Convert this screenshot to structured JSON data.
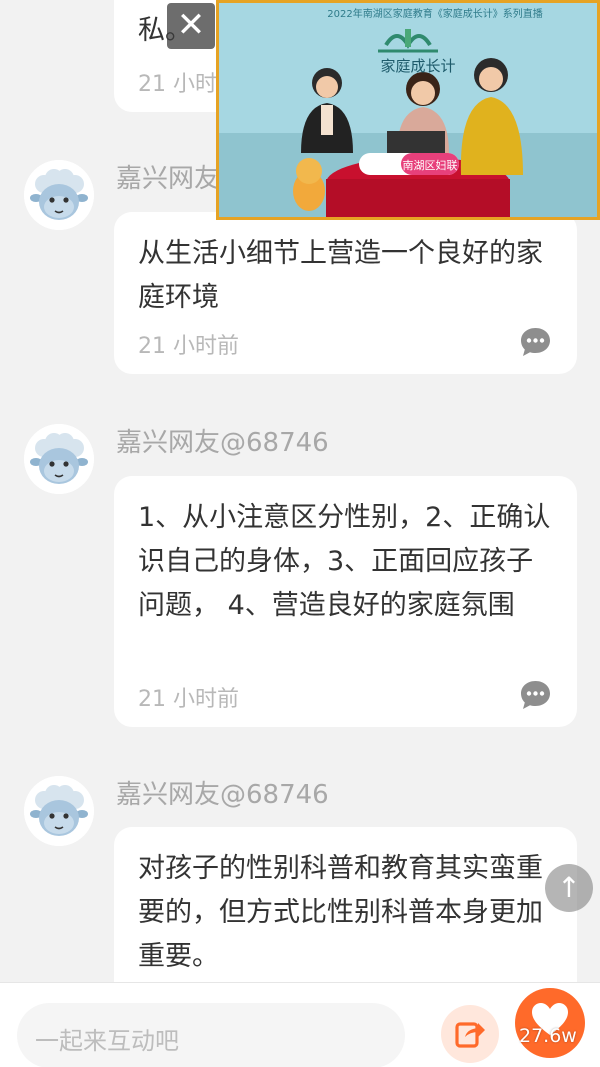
{
  "comments": [
    {
      "text": "私。",
      "time": "21 小时",
      "username": "嘉兴网友"
    },
    {
      "username": "嘉兴网友",
      "text": "从生活小细节上营造一个良好的家庭环境",
      "time": "21 小时前"
    },
    {
      "username": "嘉兴网友@68746",
      "text": "1、从小注意区分性别，2、正确认识自己的身体，3、正面回应孩子问题， 4、营造良好的家庭氛围",
      "time": "21 小时前"
    },
    {
      "username": "嘉兴网友@68746",
      "text": "对孩子的性别科普和教育其实蛮重要的，但方式比性别科普本身更加重要。"
    }
  ],
  "video": {
    "banner": "2022年南湖区家庭教育《家庭成长计》系列直播",
    "show_title": "家庭成长计",
    "badge": "南湖区妇联",
    "close_symbol": "✕"
  },
  "icons": {
    "avatar": "sheep-avatar-icon",
    "reply": "comment-bubble-icon",
    "scroll_top": "arrow-up-icon",
    "share": "share-icon",
    "like": "heart-icon"
  },
  "scroll_top_symbol": "↑",
  "bottom_bar": {
    "input_placeholder": "一起来互动吧",
    "like_count": "27.6w"
  },
  "colors": {
    "accent": "#ff6a2a",
    "video_border": "#e6a324"
  }
}
